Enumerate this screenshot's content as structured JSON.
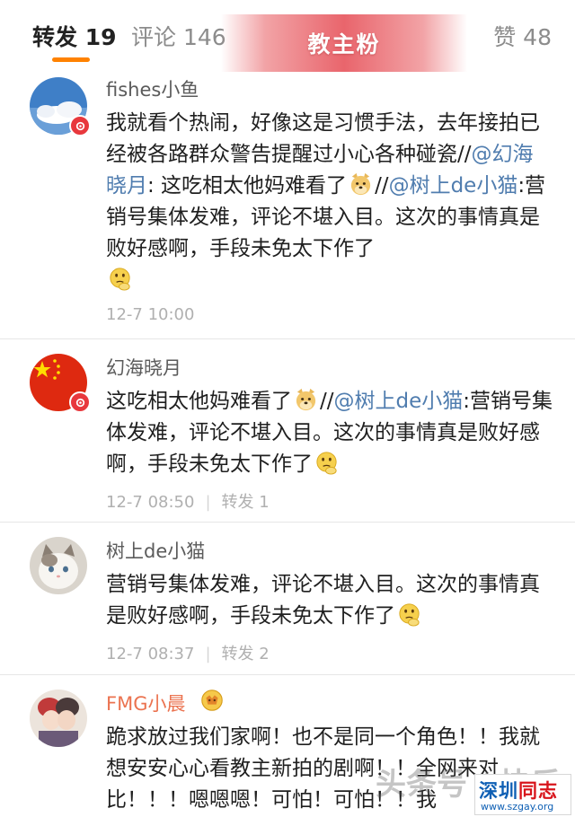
{
  "tabs": {
    "repost": "转发 19",
    "comment": "评论 146",
    "like": "赞 48",
    "tag": "教主粉"
  },
  "colors": {
    "accent": "#ff8200",
    "mention": "#507daf",
    "vip_name": "#eb7350",
    "badge": "#e8383d"
  },
  "reposts": [
    {
      "user": "fishes小鱼",
      "avatar_icon": "sky-cloud-avatar",
      "text1": "我就看个热闹，好像这是习惯手法，去年接拍已经被各路群众警告提醒过小心各种碰瓷//",
      "mention1": "@幻海晓月",
      "text2": ": 这吃相太他妈难看了",
      "emoji1": "doge-emoji",
      "text3": "//",
      "mention2": "@树上de小猫",
      "text4": ":营销号集体发难，评论不堪入目。这次的事情真是败好感啊，手段未免太下作了",
      "emoji2": "thinking-emoji",
      "time": "12-7 10:00"
    },
    {
      "user": "幻海晓月",
      "avatar_icon": "china-flag-avatar",
      "text1": "这吃相太他妈难看了",
      "emoji1": "doge-emoji",
      "text2": "//",
      "mention1": "@树上de小猫",
      "text3": ":营销号集体发难，评论不堪入目。这次的事情真是败好感啊，手段未免太下作了",
      "emoji2": "thinking-emoji",
      "time": "12-7 08:50",
      "repost": "转发 1"
    },
    {
      "user": "树上de小猫",
      "avatar_icon": "white-cat-avatar",
      "text1": "营销号集体发难，评论不堪入目。这次的事情真是败好感啊，手段未免太下作了",
      "emoji1": "thinking-emoji",
      "time": "12-7 08:37",
      "repost": "转发 2"
    },
    {
      "user": "FMG小晨",
      "avatar_icon": "anime-couple-avatar",
      "badge_icon": "fan-emoji-badge",
      "text1": "跪求放过我们家啊！也不是同一个角色！！我就想安安心心看教主新拍的剧啊！！全网来对比！！！嗯嗯嗯！可怕！可怕！！我"
    }
  ],
  "watermark": {
    "text": "头条号 / 快乐",
    "logo_cn_1": "深圳",
    "logo_cn_2": "同志",
    "logo_url": "www.szgay.org"
  }
}
